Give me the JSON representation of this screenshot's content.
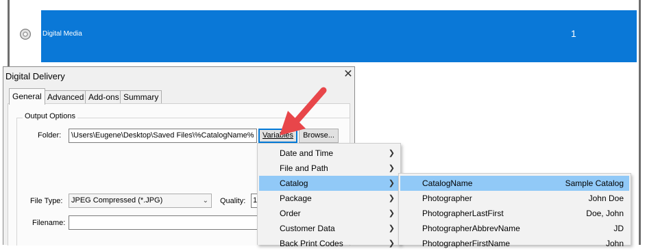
{
  "background_list": {
    "row_label": "Digital Media",
    "row_count": "1",
    "colors": {
      "selection": "#0a78d7"
    }
  },
  "dialog": {
    "title": "Digital Delivery",
    "close_glyph": "✕",
    "tabs": [
      {
        "label": "General",
        "active": true
      },
      {
        "label": "Advanced",
        "active": false
      },
      {
        "label": "Add-ons",
        "active": false
      },
      {
        "label": "Summary",
        "active": false
      }
    ],
    "output_options": {
      "legend": "Output Options",
      "folder_label": "Folder:",
      "folder_value": "\\Users\\Eugene\\Desktop\\Saved Files\\%CatalogName%",
      "variables_button": "Variables",
      "browse_button": "Browse...",
      "file_type_label": "File Type:",
      "file_type_value": "JPEG Compressed (*.JPG)",
      "quality_label": "Quality:",
      "quality_value": "1",
      "filename_label": "Filename:",
      "filename_value": ""
    }
  },
  "variables_menu": {
    "items": [
      {
        "label": "Date and Time",
        "has_submenu": true,
        "highlighted": false
      },
      {
        "label": "File and Path",
        "has_submenu": true,
        "highlighted": false
      },
      {
        "label": "Catalog",
        "has_submenu": true,
        "highlighted": true
      },
      {
        "label": "Package",
        "has_submenu": true,
        "highlighted": false
      },
      {
        "label": "Order",
        "has_submenu": true,
        "highlighted": false
      },
      {
        "label": "Customer Data",
        "has_submenu": true,
        "highlighted": false
      },
      {
        "label": "Back Print Codes",
        "has_submenu": true,
        "highlighted": false
      }
    ]
  },
  "catalog_submenu": {
    "items": [
      {
        "label": "CatalogName",
        "value": "Sample Catalog",
        "highlighted": true
      },
      {
        "label": "Photographer",
        "value": "John Doe",
        "highlighted": false
      },
      {
        "label": "PhotographerLastFirst",
        "value": "Doe, John",
        "highlighted": false
      },
      {
        "label": "PhotographerAbbrevName",
        "value": "JD",
        "highlighted": false
      },
      {
        "label": "PhotographerFirstName",
        "value": "John",
        "highlighted": false
      }
    ]
  },
  "colors": {
    "menu_highlight": "#91c9f7",
    "arrow": "#e8464a",
    "focus_border": "#0078d7"
  }
}
